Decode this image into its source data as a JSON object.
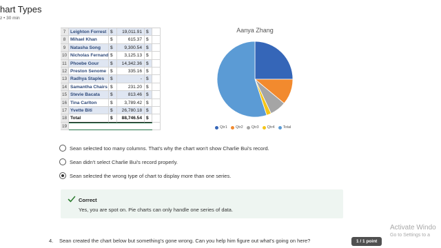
{
  "header": {
    "title": "hart Types",
    "subtitle": "z • 30 min"
  },
  "spreadsheet": {
    "rows": [
      {
        "num": "7",
        "name": "Leighton Forrest",
        "cur": "$",
        "val": "19,011.91",
        "cur2": "$"
      },
      {
        "num": "8",
        "name": "Mihael Khan",
        "cur": "$",
        "val": "615.37",
        "cur2": "$"
      },
      {
        "num": "9",
        "name": "Natasha Song",
        "cur": "$",
        "val": "9,300.54",
        "cur2": "$"
      },
      {
        "num": "10",
        "name": "Nicholas Fernandez",
        "cur": "$",
        "val": "3,125.13",
        "cur2": "$"
      },
      {
        "num": "11",
        "name": "Phoebe Gour",
        "cur": "$",
        "val": "14,342.36",
        "cur2": "$"
      },
      {
        "num": "12",
        "name": "Preston Senome",
        "cur": "$",
        "val": "335.16",
        "cur2": "$"
      },
      {
        "num": "13",
        "name": "Radhya Staples",
        "cur": "$",
        "val": "-",
        "cur2": "$"
      },
      {
        "num": "14",
        "name": "Samantha Chairs",
        "cur": "$",
        "val": "231.20",
        "cur2": "$"
      },
      {
        "num": "15",
        "name": "Stevie Bacata",
        "cur": "$",
        "val": "813.46",
        "cur2": "$"
      },
      {
        "num": "16",
        "name": "Tina Carlton",
        "cur": "$",
        "val": "3,789.42",
        "cur2": "$"
      },
      {
        "num": "17",
        "name": "Yvette Biti",
        "cur": "$",
        "val": "26,780.18",
        "cur2": "$"
      },
      {
        "num": "18",
        "name": "Total",
        "cur": "$",
        "val": "88,746.54",
        "cur2": "$"
      },
      {
        "num": "19",
        "name": "",
        "cur": "",
        "val": "",
        "cur2": ""
      }
    ]
  },
  "chart_data": {
    "type": "pie",
    "title": "Aanya Zhang",
    "categories": [
      "Qtr1",
      "Qtr2",
      "Qtr3",
      "Qtr4",
      "Total"
    ],
    "values": [
      25,
      11,
      7,
      2,
      55
    ],
    "colors": [
      "#3566b8",
      "#f28a2e",
      "#a5a5a5",
      "#f5c518",
      "#5b9bd5"
    ],
    "legend_position": "bottom"
  },
  "options": [
    {
      "label": "Sean selected too many columns. That's why the chart won't show Charlie Bui's record.",
      "checked": false
    },
    {
      "label": "Sean didn't select Charlie Bui's record properly.",
      "checked": false
    },
    {
      "label": "Sean selected the wrong type of chart to display more than one series.",
      "checked": true
    }
  ],
  "feedback": {
    "title": "Correct",
    "text": "Yes, you are spot on. Pie charts can only handle one series of data.",
    "icon": "check-icon",
    "accent": "#2e7d32"
  },
  "question": {
    "number": "4.",
    "text": "Sean created the chart below but something's gone wrong. Can you help him figure out what's going on here?",
    "points": "1 / 1 point"
  },
  "watermark": {
    "title": "Activate Windo",
    "subtitle": "Go to Settings to a"
  }
}
